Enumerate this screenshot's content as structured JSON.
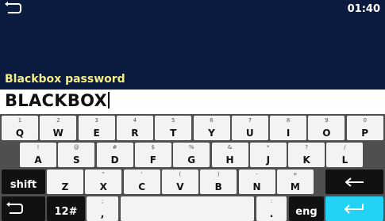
{
  "header": {
    "clock": "01:40",
    "field_label": "Blackbox password",
    "back_icon": "back-arrow-icon"
  },
  "input": {
    "value": "BLACKBOX"
  },
  "keyboard": {
    "row1": [
      {
        "num": "1",
        "key": "Q"
      },
      {
        "num": "2",
        "key": "W"
      },
      {
        "num": "3",
        "key": "E"
      },
      {
        "num": "4",
        "key": "R"
      },
      {
        "num": "5",
        "key": "T"
      },
      {
        "num": "6",
        "key": "Y"
      },
      {
        "num": "7",
        "key": "U"
      },
      {
        "num": "8",
        "key": "I"
      },
      {
        "num": "9",
        "key": "O"
      },
      {
        "num": "0",
        "key": "P"
      }
    ],
    "row2": [
      {
        "num": "!",
        "key": "A"
      },
      {
        "num": "@",
        "key": "S"
      },
      {
        "num": "#",
        "key": "D"
      },
      {
        "num": "$",
        "key": "F"
      },
      {
        "num": "%",
        "key": "G"
      },
      {
        "num": "&",
        "key": "H"
      },
      {
        "num": "*",
        "key": "J"
      },
      {
        "num": "?",
        "key": "K"
      },
      {
        "num": "/",
        "key": "L"
      }
    ],
    "row3": [
      {
        "num": "",
        "key": "Z"
      },
      {
        "num": "\"",
        "key": "X"
      },
      {
        "num": "'",
        "key": "C"
      },
      {
        "num": "(",
        "key": "V"
      },
      {
        "num": ")",
        "key": "B"
      },
      {
        "num": "-",
        "key": "N"
      },
      {
        "num": "+",
        "key": "M"
      }
    ],
    "shift_label": "shift",
    "numeric_label": "12#",
    "comma_key": {
      "num": ";",
      "key": ","
    },
    "period_key": {
      "num": ":",
      "key": "."
    },
    "lang_label": "eng",
    "accent_color": "#23d3f5"
  }
}
